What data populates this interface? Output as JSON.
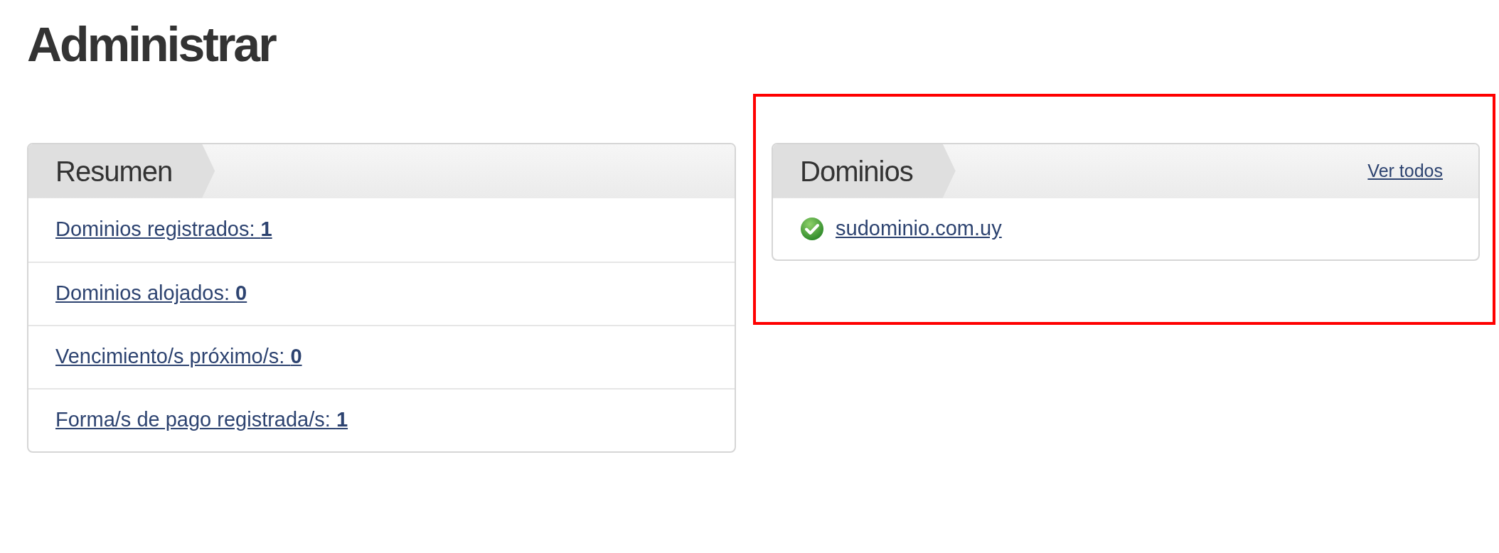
{
  "page_title": "Administrar",
  "summary": {
    "title": "Resumen",
    "items": [
      {
        "text": "Dominios registrados: **1**"
      },
      {
        "text": "Dominios alojados: **0**"
      },
      {
        "text": "Vencimiento/s próximo/s: **0**"
      },
      {
        "text": "Forma/s de pago registrada/s: **1**"
      }
    ]
  },
  "domains": {
    "title": "Dominios",
    "view_all": "Ver todos",
    "highlighted": true,
    "items": [
      {
        "name": "sudominio.com.uy",
        "active": true
      }
    ]
  }
}
